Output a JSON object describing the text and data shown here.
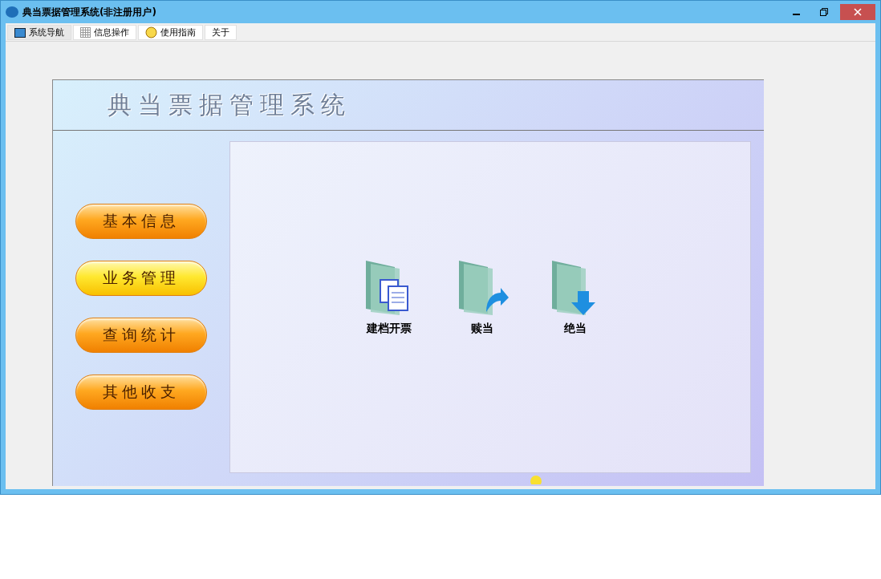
{
  "window": {
    "title": "典当票据管理系统(非注册用户)"
  },
  "tabs": [
    {
      "label": "系统导航",
      "selected": true,
      "kind": "monitor"
    },
    {
      "label": "信息操作",
      "selected": false,
      "kind": "grid"
    },
    {
      "label": "使用指南",
      "selected": false,
      "kind": "help"
    },
    {
      "label": "关于",
      "selected": false,
      "kind": "none"
    }
  ],
  "banner": {
    "title": "典当票据管理系统"
  },
  "menu_buttons": [
    {
      "label": "基本信息",
      "selected": false
    },
    {
      "label": "业务管理",
      "selected": true
    },
    {
      "label": "查询统计",
      "selected": false
    },
    {
      "label": "其他收支",
      "selected": false
    }
  ],
  "actions": [
    {
      "label": "建档开票",
      "kind": "documents"
    },
    {
      "label": "赎当",
      "kind": "redeem"
    },
    {
      "label": "绝当",
      "kind": "forfeit"
    }
  ]
}
